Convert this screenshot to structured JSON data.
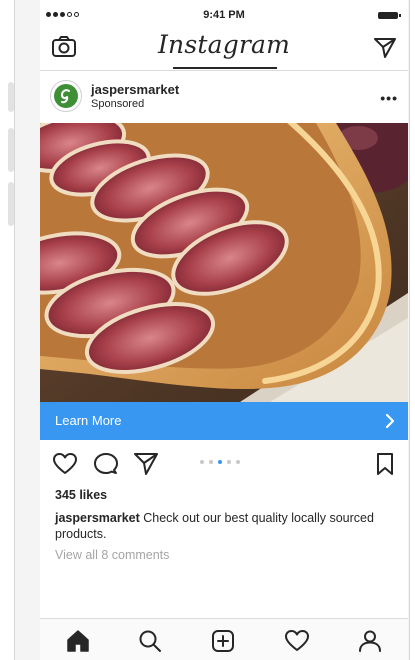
{
  "status_bar": {
    "time": "9:41 PM"
  },
  "header": {
    "logo_text": "Instagram"
  },
  "post": {
    "username": "jaspersmarket",
    "sponsored_label": "Sponsored",
    "more_label": "•••",
    "cta_label": "Learn More",
    "likes": "345 likes",
    "caption_user": "jaspersmarket",
    "caption_text": " Check out our best quality locally sourced products.",
    "view_comments": "View all 8 comments",
    "carousel": {
      "count": 5,
      "active_index": 2
    }
  },
  "icons": {
    "top_left": "camera-icon",
    "top_right": "direct-message-icon",
    "actions": [
      "heart-icon",
      "comment-icon",
      "share-icon",
      "bookmark-icon"
    ],
    "bottom_nav": [
      "home-icon",
      "search-icon",
      "add-post-icon",
      "activity-heart-icon",
      "profile-icon"
    ]
  },
  "colors": {
    "accent_blue": "#3897f0",
    "text_primary": "#262626",
    "text_muted": "#a5a5a5",
    "avatar_green": "#3f8f37"
  }
}
